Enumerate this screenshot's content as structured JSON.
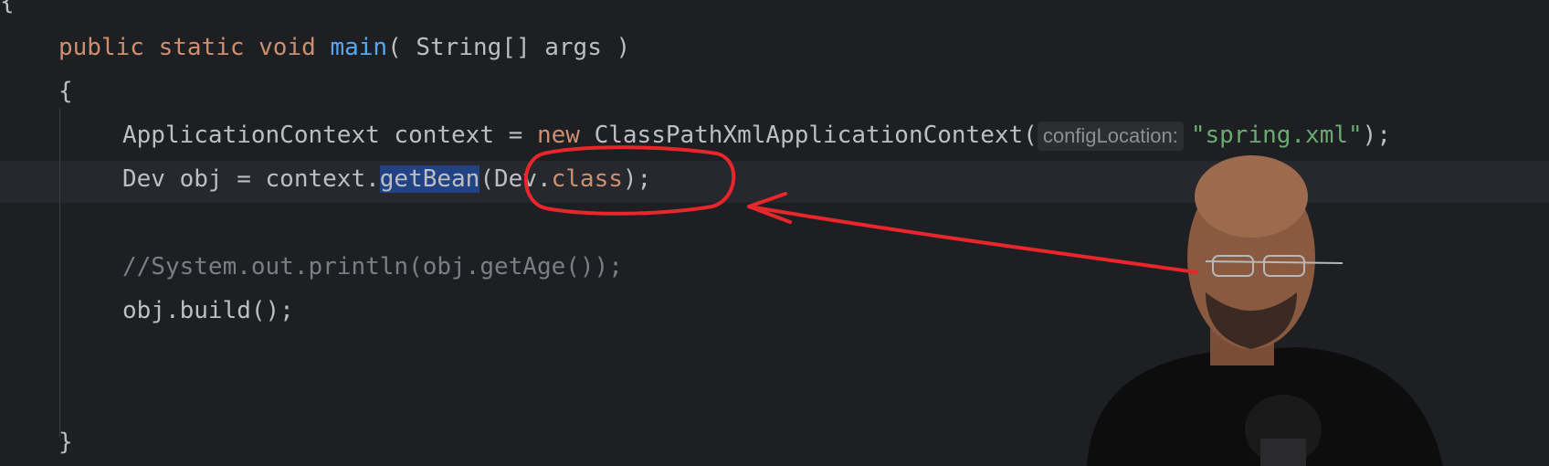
{
  "code": {
    "line_open_top": "{",
    "main_kw1": "public",
    "main_kw2": "static",
    "main_kw3": "void",
    "main_name": "main",
    "main_params": "( String[] args )",
    "brace_open": "{",
    "ctx_type": "ApplicationContext context = ",
    "ctx_new": "new",
    "ctx_class": " ClassPathXmlApplicationContext(",
    "ctx_hint": "configLocation:",
    "ctx_arg": "\"spring.xml\"",
    "ctx_end": ");",
    "obj_decl": "Dev obj = context.",
    "obj_call": "getBean",
    "obj_args_open": "(Dev.",
    "obj_args_kw": "class",
    "obj_args_close": ");",
    "comment_line": "//System.out.println(obj.getAge());",
    "build_line": "obj.build();",
    "brace_close": "}"
  },
  "annotation": {
    "color": "#e8262b"
  }
}
